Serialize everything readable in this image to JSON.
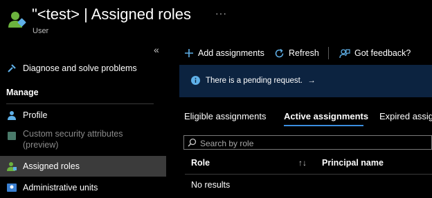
{
  "header": {
    "title": "\"<test> | Assigned roles",
    "subtitle": "User",
    "more_label": "···"
  },
  "sidebar": {
    "collapse_label": "«",
    "items": [
      {
        "label": "Diagnose and solve problems",
        "icon": "wrench-icon"
      },
      {
        "label": "Profile",
        "icon": "person-icon"
      },
      {
        "label": "Custom security attributes (preview)",
        "icon": "shield-icon"
      },
      {
        "label": "Assigned roles",
        "icon": "user-roles-icon"
      },
      {
        "label": "Administrative units",
        "icon": "admin-units-icon"
      }
    ],
    "section_manage": "Manage"
  },
  "toolbar": {
    "add_label": "Add assignments",
    "refresh_label": "Refresh",
    "feedback_label": "Got feedback?"
  },
  "banner": {
    "text": "There is a pending request.",
    "arrow": "→",
    "background": "#0c2340"
  },
  "tabs": [
    {
      "label": "Eligible assignments"
    },
    {
      "label": "Active assignments",
      "active": true
    },
    {
      "label": "Expired assig"
    }
  ],
  "search": {
    "placeholder": "Search by role"
  },
  "table": {
    "columns": [
      "Role",
      "Principal name"
    ],
    "sort_icon": "↑↓",
    "empty_text": "No results"
  },
  "colors": {
    "accent": "#3b8ee0",
    "background": "#000000",
    "active_nav": "#3b3b3b"
  }
}
